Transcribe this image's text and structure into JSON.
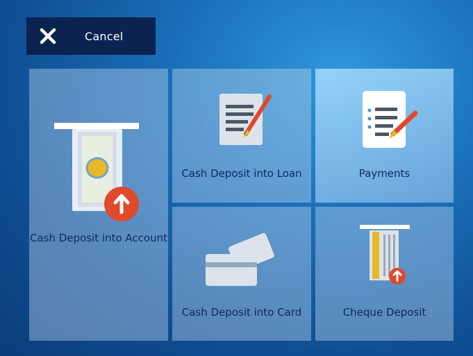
{
  "cancel": {
    "label": "Cancel",
    "icon": "close-icon"
  },
  "tiles": [
    {
      "label": "Cash Deposit into Account",
      "icon": "cash-deposit-icon"
    },
    {
      "label": "Cash Deposit into Loan",
      "icon": "document-pen-icon"
    },
    {
      "label": "Payments",
      "icon": "checklist-pen-icon"
    },
    {
      "label": "Cash Deposit into Card",
      "icon": "cards-icon"
    },
    {
      "label": "Cheque Deposit",
      "icon": "cheque-deposit-icon"
    }
  ],
  "colors": {
    "background": "#1a6fb8",
    "cancel_bg": "#0c2350",
    "accent_orange": "#e0492b",
    "tile_text": "#102a57"
  }
}
